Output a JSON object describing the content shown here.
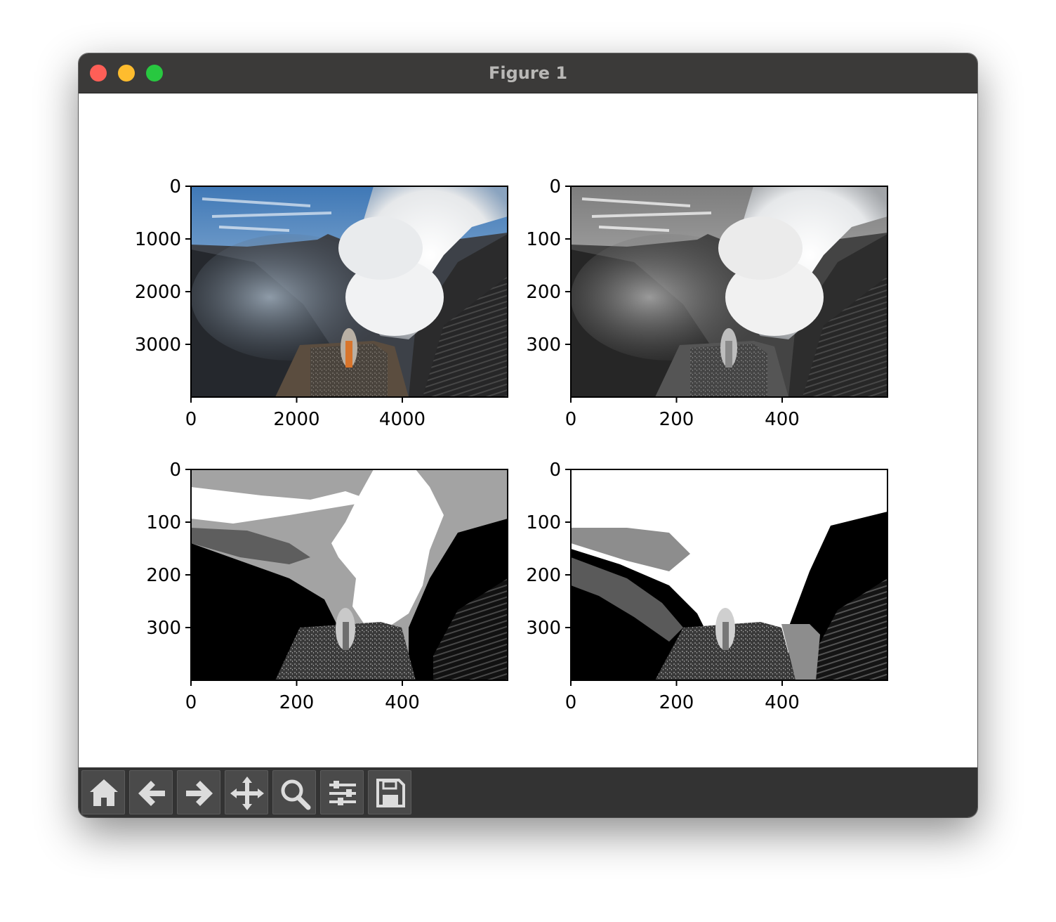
{
  "window": {
    "title": "Figure 1"
  },
  "chart_data": [
    {
      "type": "image",
      "description_kind": "rgb-photo",
      "xticks": [
        "0",
        "2000",
        "4000"
      ],
      "yticks": [
        "0",
        "1000",
        "2000",
        "3000"
      ]
    },
    {
      "type": "image",
      "description_kind": "grayscale",
      "xticks": [
        "0",
        "200",
        "400"
      ],
      "yticks": [
        "0",
        "100",
        "200",
        "300"
      ]
    },
    {
      "type": "image",
      "description_kind": "quantized",
      "xticks": [
        "0",
        "200",
        "400"
      ],
      "yticks": [
        "0",
        "100",
        "200",
        "300"
      ]
    },
    {
      "type": "image",
      "description_kind": "quantized",
      "xticks": [
        "0",
        "200",
        "400"
      ],
      "yticks": [
        "0",
        "100",
        "200",
        "300"
      ]
    }
  ],
  "toolbar": {
    "buttons": [
      {
        "name": "home-button",
        "icon": "home-icon"
      },
      {
        "name": "back-button",
        "icon": "arrow-left-icon"
      },
      {
        "name": "forward-button",
        "icon": "arrow-right-icon"
      },
      {
        "name": "pan-button",
        "icon": "move-icon"
      },
      {
        "name": "zoom-button",
        "icon": "magnifier-icon"
      },
      {
        "name": "configure-subplots-button",
        "icon": "sliders-icon"
      },
      {
        "name": "save-button",
        "icon": "floppy-icon"
      }
    ]
  }
}
